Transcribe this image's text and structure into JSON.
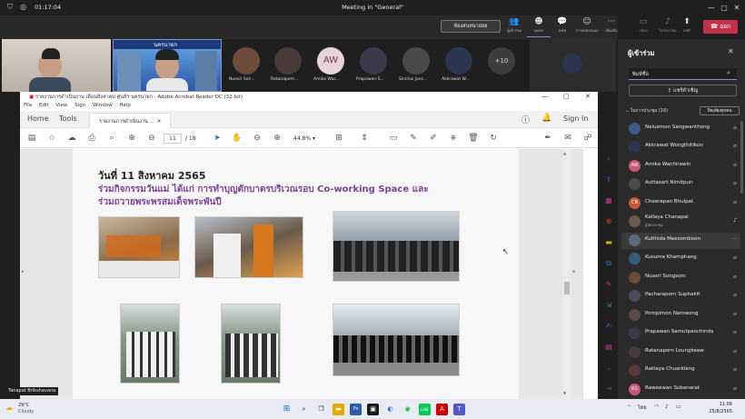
{
  "window": {
    "title": "Meeting in \"General\"",
    "elapsed": "01:17:04"
  },
  "meeting": {
    "breakout_button": "ห้องสนทนาย่อย",
    "controls": [
      {
        "label": "ผู้เข้าร่วม",
        "icon": "people-icon"
      },
      {
        "label": "แชท",
        "icon": "chat-icon"
      },
      {
        "label": "การตอบสนอง",
        "icon": "reaction-icon"
      },
      {
        "label": "เพิ่มเติม",
        "icon": "more-icon"
      },
      {
        "label": "กล้อง",
        "icon": "camera-off-icon"
      },
      {
        "label": "ไมโครโฟน",
        "icon": "mic-off-icon"
      },
      {
        "label": "แชร์",
        "icon": "share-icon"
      }
    ],
    "leave_label": "ออก"
  },
  "video_strip": {
    "presenter_banner": "นครนายก",
    "tiles": [
      {
        "name": "Nuesri Son...",
        "color": "#6b4b3a"
      },
      {
        "name": "Ratanapom...",
        "color": "#4a3a3a"
      },
      {
        "name": "Amika Wac...",
        "initials": "AW",
        "color": "#e8d3d8"
      },
      {
        "name": "Prapawan S...",
        "color": "#3a3a4a"
      },
      {
        "name": "Sinchai Jans...",
        "color": "#4a4a4a"
      },
      {
        "name": "Akkrawat W...",
        "color": "#2a3550"
      }
    ],
    "more_count": "+10"
  },
  "acrobat": {
    "title": "รายงานการดำเนินงาน เดือนสิงหาคม ศูนย์ฯ นครนายก - Adobe Acrobat Reader DC (32-bit)",
    "menu": [
      "File",
      "Edit",
      "View",
      "Sign",
      "Window",
      "Help"
    ],
    "tabs": {
      "home": "Home",
      "tools": "Tools",
      "document": "รายงานการดำเนินงาน ..."
    },
    "sign_in": "Sign In",
    "page_current": "11",
    "page_total": "/ 18",
    "zoom": "44.8%",
    "document": {
      "date_heading": "วันที่ 11 สิงหาคม 2565",
      "activity_line1": "ร่วมกิจกรรมวันแม่ ได้แก่ การทำบุญตักบาตรบริเวณรอบ Co-working Space และ",
      "activity_line2": "ร่วมถวายพระพรสมเด็จพระพันปี"
    }
  },
  "speaker_caption": "Tanapat Brikshavana",
  "panel": {
    "title": "ผู้เข้าร่วม",
    "search_placeholder": "พิมพ์ชื่อ",
    "share_invite": "แชร์คำเชิญ",
    "section_label": "ในการประชุม (16)",
    "mute_all": "ปิดเสียงทุกคน",
    "participants": [
      {
        "name": "Naluemon Sangwanthong",
        "color": "#3b5b8a"
      },
      {
        "name": "Akkrawat Wongthitikun",
        "color": "#2a3550"
      },
      {
        "name": "Amika Wachirawin",
        "initials": "AW",
        "color": "#c45a77"
      },
      {
        "name": "Auttasart Nimitpun",
        "color": "#4a4a4a"
      },
      {
        "name": "Cheerapan Bhulpat",
        "initials": "CB",
        "color": "#c4573a"
      },
      {
        "name": "Kallaya Chanapai",
        "subtitle": "ผู้จัดประชุม",
        "color": "#6b5a4a"
      },
      {
        "name": "Kulthida Meesomboon",
        "color": "#5a6b7a"
      },
      {
        "name": "Kusuma Khamphang",
        "color": "#3a5a7a"
      },
      {
        "name": "Nuasri Songsom",
        "color": "#6b4b3a"
      },
      {
        "name": "Pacharaporn Suphakit",
        "color": "#4a4a5a"
      },
      {
        "name": "Pompimon Namwong",
        "color": "#5a4a4a"
      },
      {
        "name": "Prapawan Samutpaochinda",
        "color": "#3a3a4a"
      },
      {
        "name": "Ratanaporn Loungkeaw",
        "color": "#4a3a3a"
      },
      {
        "name": "Rattaya Chuarklang",
        "color": "#5a3a3a"
      },
      {
        "name": "Raweewan Subanarat",
        "initials": "RS",
        "color": "#c45a77"
      }
    ]
  },
  "taskbar": {
    "weather_temp": "29°C",
    "weather_desc": "Cloudy",
    "language": "ไทย",
    "time": "11:06",
    "date": "25/8/2565"
  }
}
